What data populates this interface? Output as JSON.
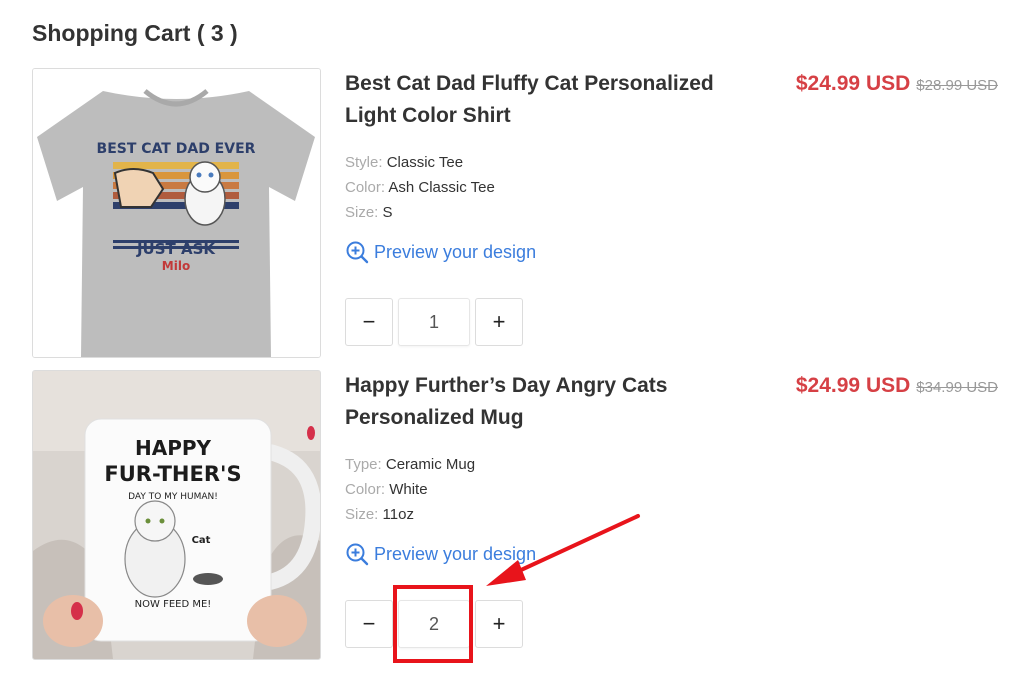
{
  "cart": {
    "title": "Shopping Cart ( 3 )"
  },
  "items": [
    {
      "name": "Best Cat Dad Fluffy Cat Personalized Light Color Shirt",
      "price_now": "$24.99 USD",
      "price_was": "$28.99 USD",
      "attrs": [
        {
          "key": "Style:",
          "value": "Classic Tee"
        },
        {
          "key": "Color:",
          "value": "Ash Classic Tee"
        },
        {
          "key": "Size:",
          "value": "S"
        }
      ],
      "preview_label": "Preview your design",
      "quantity": "1",
      "image": {
        "line1": "BEST CAT DAD EVER",
        "line2": "JUST ASK",
        "line3": "Milo"
      }
    },
    {
      "name": "Happy Further’s Day Angry Cats Personalized Mug",
      "price_now": "$24.99 USD",
      "price_was": "$34.99 USD",
      "attrs": [
        {
          "key": "Type:",
          "value": "Ceramic Mug"
        },
        {
          "key": "Color:",
          "value": "White"
        },
        {
          "key": "Size:",
          "value": "11oz"
        }
      ],
      "preview_label": "Preview your design",
      "quantity": "2",
      "image": {
        "line1": "HAPPY",
        "line2": "FUR-THER'S",
        "line3": "DAY TO MY HUMAN!",
        "line4": "Cat",
        "line5": "NOW FEED ME!"
      }
    }
  ],
  "quantity_controls": {
    "minus": "−",
    "plus": "+"
  },
  "colors": {
    "price": "#d64045",
    "link": "#3b7ddd",
    "annotation": "#e8141b"
  }
}
